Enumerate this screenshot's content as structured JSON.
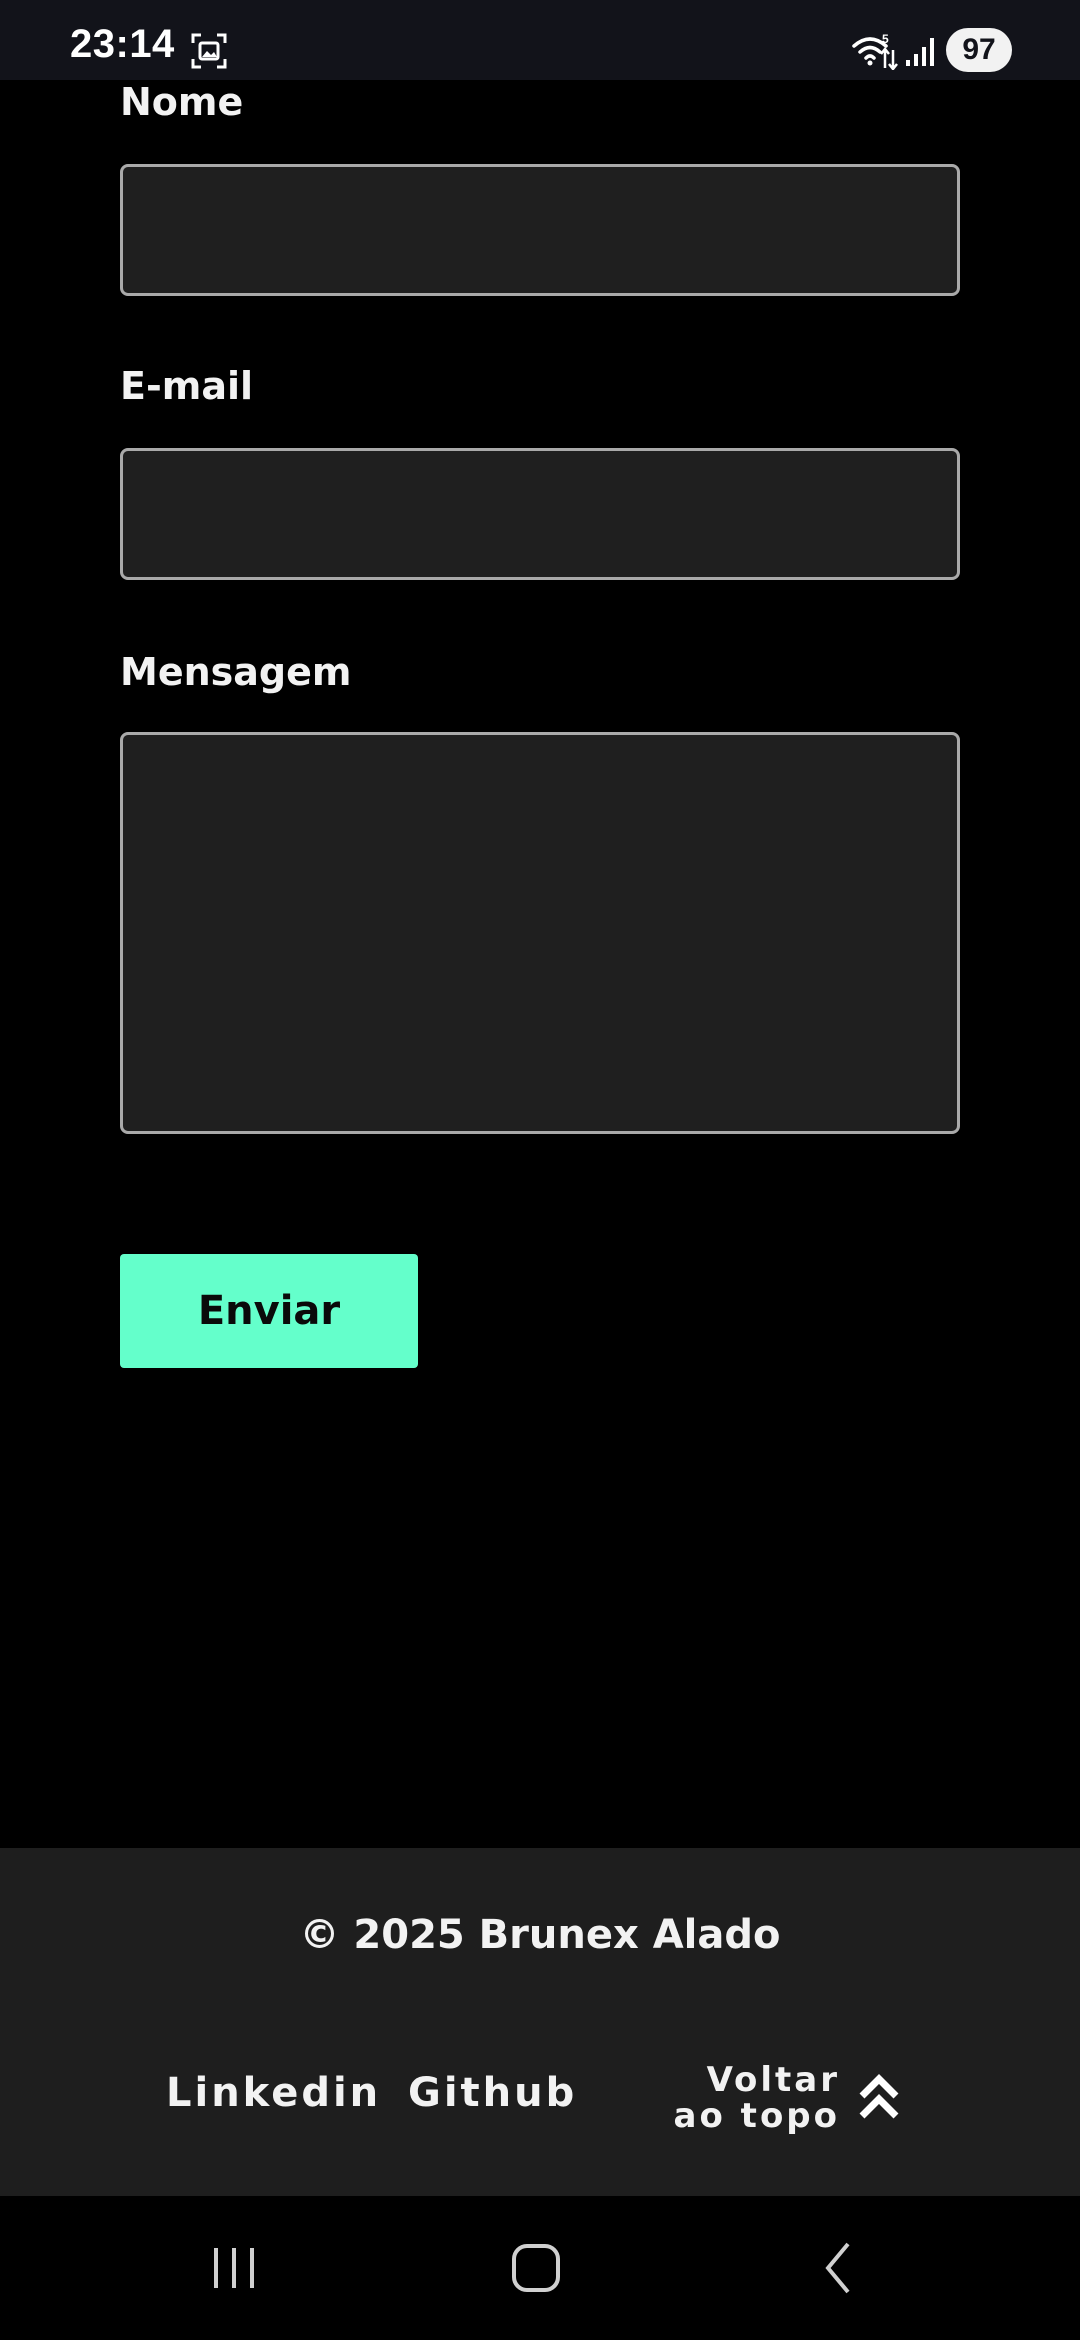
{
  "status_bar": {
    "time": "23:14",
    "battery": "97",
    "icons": [
      "screen-record-icon",
      "wifi-icon",
      "signal-icon"
    ]
  },
  "form": {
    "name_label": "Nome",
    "name_value": "",
    "email_label": "E-mail",
    "email_value": "",
    "message_label": "Mensagem",
    "message_value": "",
    "submit_label": "Enviar"
  },
  "footer": {
    "copyright": "© 2025 Brunex Alado",
    "links": {
      "linkedin": "Linkedin",
      "github": "Github"
    },
    "back_to_top": {
      "line1": "Voltar",
      "line2": "ao topo",
      "icon": "chevrons-up-icon"
    }
  },
  "nav_bar": {
    "buttons": [
      "recent-apps-icon",
      "home-icon",
      "back-icon"
    ]
  },
  "colors": {
    "background": "#000000",
    "field_background": "#1f1f1f",
    "field_border": "#a9a9a9",
    "accent": "#64ffcb",
    "footer_background": "#1e1e1e",
    "status_bar": "#12131a"
  }
}
